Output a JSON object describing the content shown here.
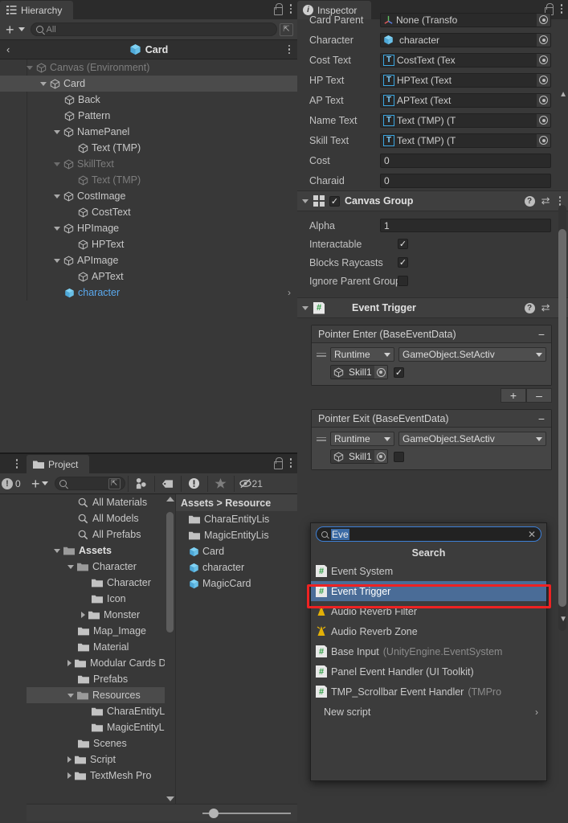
{
  "hierarchy": {
    "tab_label": "Hierarchy",
    "search_placeholder": "All",
    "breadcrumb_title": "Card",
    "items": [
      {
        "label": "Canvas (Environment)",
        "depth": 1,
        "expanded": true,
        "dim": true,
        "selected": false,
        "icon": "gameobject-outline-icon",
        "chevron": false
      },
      {
        "label": "Card",
        "depth": 2,
        "expanded": true,
        "dim": false,
        "selected": true,
        "icon": "gameobject-outline-icon",
        "chevron": false
      },
      {
        "label": "Back",
        "depth": 3,
        "expanded": null,
        "dim": false,
        "selected": false,
        "icon": "gameobject-outline-icon",
        "chevron": false
      },
      {
        "label": "Pattern",
        "depth": 3,
        "expanded": null,
        "dim": false,
        "selected": false,
        "icon": "gameobject-outline-icon",
        "chevron": false
      },
      {
        "label": "NamePanel",
        "depth": 3,
        "expanded": true,
        "dim": false,
        "selected": false,
        "icon": "gameobject-outline-icon",
        "chevron": false
      },
      {
        "label": "Text (TMP)",
        "depth": 4,
        "expanded": null,
        "dim": false,
        "selected": false,
        "icon": "gameobject-outline-icon",
        "chevron": false
      },
      {
        "label": "SkillText",
        "depth": 3,
        "expanded": true,
        "dim": true,
        "selected": false,
        "icon": "gameobject-outline-icon",
        "chevron": false
      },
      {
        "label": "Text (TMP)",
        "depth": 4,
        "expanded": null,
        "dim": true,
        "selected": false,
        "icon": "gameobject-outline-icon",
        "chevron": false
      },
      {
        "label": "CostImage",
        "depth": 3,
        "expanded": true,
        "dim": false,
        "selected": false,
        "icon": "gameobject-outline-icon",
        "chevron": false
      },
      {
        "label": "CostText",
        "depth": 4,
        "expanded": null,
        "dim": false,
        "selected": false,
        "icon": "gameobject-outline-icon",
        "chevron": false
      },
      {
        "label": "HPImage",
        "depth": 3,
        "expanded": true,
        "dim": false,
        "selected": false,
        "icon": "gameobject-outline-icon",
        "chevron": false
      },
      {
        "label": "HPText",
        "depth": 4,
        "expanded": null,
        "dim": false,
        "selected": false,
        "icon": "gameobject-outline-icon",
        "chevron": false
      },
      {
        "label": "APImage",
        "depth": 3,
        "expanded": true,
        "dim": false,
        "selected": false,
        "icon": "gameobject-outline-icon",
        "chevron": false
      },
      {
        "label": "APText",
        "depth": 4,
        "expanded": null,
        "dim": false,
        "selected": false,
        "icon": "gameobject-outline-icon",
        "chevron": false
      },
      {
        "label": "character",
        "depth": 3,
        "expanded": null,
        "dim": false,
        "selected": false,
        "icon": "prefab-cube-icon",
        "chevron": true,
        "prefab": true
      }
    ]
  },
  "console": {
    "error_count": "0"
  },
  "project": {
    "tab_label": "Project",
    "search_placeholder": "",
    "toolbar_icons": [
      "avatar-mask-icon",
      "label-tag-icon",
      "warning-icon",
      "favorite-star-icon",
      "hidden-eye-icon"
    ],
    "hidden_count": "21",
    "favorites": [
      {
        "label": "All Materials",
        "icon": "search-icon"
      },
      {
        "label": "All Models",
        "icon": "search-icon"
      },
      {
        "label": "All Prefabs",
        "icon": "search-icon"
      }
    ],
    "tree": [
      {
        "label": "Assets",
        "depth": 1,
        "state": "expanded",
        "bold": true,
        "selected": false,
        "icon": "folder-open-icon"
      },
      {
        "label": "Character",
        "depth": 2,
        "state": "expanded",
        "bold": false,
        "selected": false,
        "icon": "folder-open-icon"
      },
      {
        "label": "Character",
        "depth": 3,
        "state": "leaf",
        "bold": false,
        "selected": false,
        "icon": "folder-icon"
      },
      {
        "label": "Icon",
        "depth": 3,
        "state": "leaf",
        "bold": false,
        "selected": false,
        "icon": "folder-icon"
      },
      {
        "label": "Monster",
        "depth": 3,
        "state": "collapsed",
        "bold": false,
        "selected": false,
        "icon": "folder-icon"
      },
      {
        "label": "Map_Image",
        "depth": 2,
        "state": "leaf",
        "bold": false,
        "selected": false,
        "icon": "folder-icon"
      },
      {
        "label": "Material",
        "depth": 2,
        "state": "leaf",
        "bold": false,
        "selected": false,
        "icon": "folder-icon"
      },
      {
        "label": "Modular Cards D",
        "depth": 2,
        "state": "collapsed",
        "bold": false,
        "selected": false,
        "icon": "folder-icon"
      },
      {
        "label": "Prefabs",
        "depth": 2,
        "state": "leaf",
        "bold": false,
        "selected": false,
        "icon": "folder-icon"
      },
      {
        "label": "Resources",
        "depth": 2,
        "state": "expanded",
        "bold": false,
        "selected": true,
        "icon": "folder-open-icon"
      },
      {
        "label": "CharaEntityL",
        "depth": 3,
        "state": "leaf",
        "bold": false,
        "selected": false,
        "icon": "folder-icon"
      },
      {
        "label": "MagicEntityL",
        "depth": 3,
        "state": "leaf",
        "bold": false,
        "selected": false,
        "icon": "folder-icon"
      },
      {
        "label": "Scenes",
        "depth": 2,
        "state": "leaf",
        "bold": false,
        "selected": false,
        "icon": "folder-icon"
      },
      {
        "label": "Script",
        "depth": 2,
        "state": "collapsed",
        "bold": false,
        "selected": false,
        "icon": "folder-icon"
      },
      {
        "label": "TextMesh Pro",
        "depth": 2,
        "state": "collapsed",
        "bold": false,
        "selected": false,
        "icon": "folder-icon"
      }
    ],
    "breadcrumb": "Assets  >  Resource",
    "contents": [
      {
        "label": "CharaEntityLis",
        "icon": "folder-icon"
      },
      {
        "label": "MagicEntityLis",
        "icon": "folder-icon"
      },
      {
        "label": "Card",
        "icon": "prefab-cube-icon"
      },
      {
        "label": "character",
        "icon": "prefab-cube-icon"
      },
      {
        "label": "MagicCard",
        "icon": "prefab-cube-icon"
      }
    ]
  },
  "inspector": {
    "tab_label": "Inspector",
    "script_fields": [
      {
        "label": "Card Parent",
        "value": "None (Transfo",
        "icon": "transform-icon"
      },
      {
        "label": "Character",
        "value": "character",
        "icon": "prefab-cube-icon"
      },
      {
        "label": "Cost Text",
        "value": "CostText (Tex",
        "icon": "tmp-text-icon"
      },
      {
        "label": "HP Text",
        "value": "HPText (Text",
        "icon": "tmp-text-icon"
      },
      {
        "label": "AP Text",
        "value": "APText (Text",
        "icon": "tmp-text-icon"
      },
      {
        "label": "Name Text",
        "value": "Text (TMP) (T",
        "icon": "tmp-text-icon"
      },
      {
        "label": "Skill Text",
        "value": "Text (TMP) (T",
        "icon": "tmp-text-icon"
      }
    ],
    "number_fields": [
      {
        "label": "Cost",
        "value": "0"
      },
      {
        "label": "Charaid",
        "value": "0"
      }
    ],
    "canvas_group": {
      "title": "Canvas Group",
      "enabled": true,
      "alpha_label": "Alpha",
      "alpha_value": "1",
      "rows": [
        {
          "label": "Interactable",
          "checked": true
        },
        {
          "label": "Blocks Raycasts",
          "checked": true
        },
        {
          "label": "Ignore Parent Groups",
          "checked": false
        }
      ]
    },
    "event_trigger": {
      "title": "Event Trigger",
      "entries": [
        {
          "header": "Pointer Enter (BaseEventData)",
          "runtime_label": "Runtime",
          "function_label": "GameObject.SetActiv",
          "object_label": "Skill1",
          "arg_checked": true,
          "show_plusminus": true,
          "plus_label": "+",
          "minus_label": "–"
        },
        {
          "header": "Pointer Exit (BaseEventData)",
          "runtime_label": "Runtime",
          "function_label": "GameObject.SetActiv",
          "object_label": "Skill1",
          "arg_checked": false,
          "show_plusminus": false,
          "plus_label": "+",
          "minus_label": "–"
        }
      ]
    },
    "partial_tab_label": "In"
  },
  "add_component_popup": {
    "query": "Eve",
    "title": "Search",
    "items": [
      {
        "label": "Event System",
        "suffix": "",
        "icon": "script-icon",
        "selected": false
      },
      {
        "label": "Event Trigger",
        "suffix": "",
        "icon": "script-icon",
        "selected": true
      },
      {
        "label": "Audio Reverb Filter",
        "suffix": "",
        "icon": "audio-filter-icon",
        "selected": false
      },
      {
        "label": "Audio Reverb Zone",
        "suffix": "",
        "icon": "audio-zone-icon",
        "selected": false
      },
      {
        "label": "Base Input",
        "suffix": " (UnityEngine.EventSystem",
        "icon": "script-icon",
        "selected": false
      },
      {
        "label": "Panel Event Handler (UI Toolkit)",
        "suffix": "",
        "icon": "script-icon",
        "selected": false
      },
      {
        "label": "TMP_Scrollbar Event Handler",
        "suffix": " (TMPro",
        "icon": "script-icon",
        "selected": false
      }
    ],
    "new_script_label": "New script",
    "highlight_color": "#ee2222",
    "selection_color": "#4a6c97"
  }
}
